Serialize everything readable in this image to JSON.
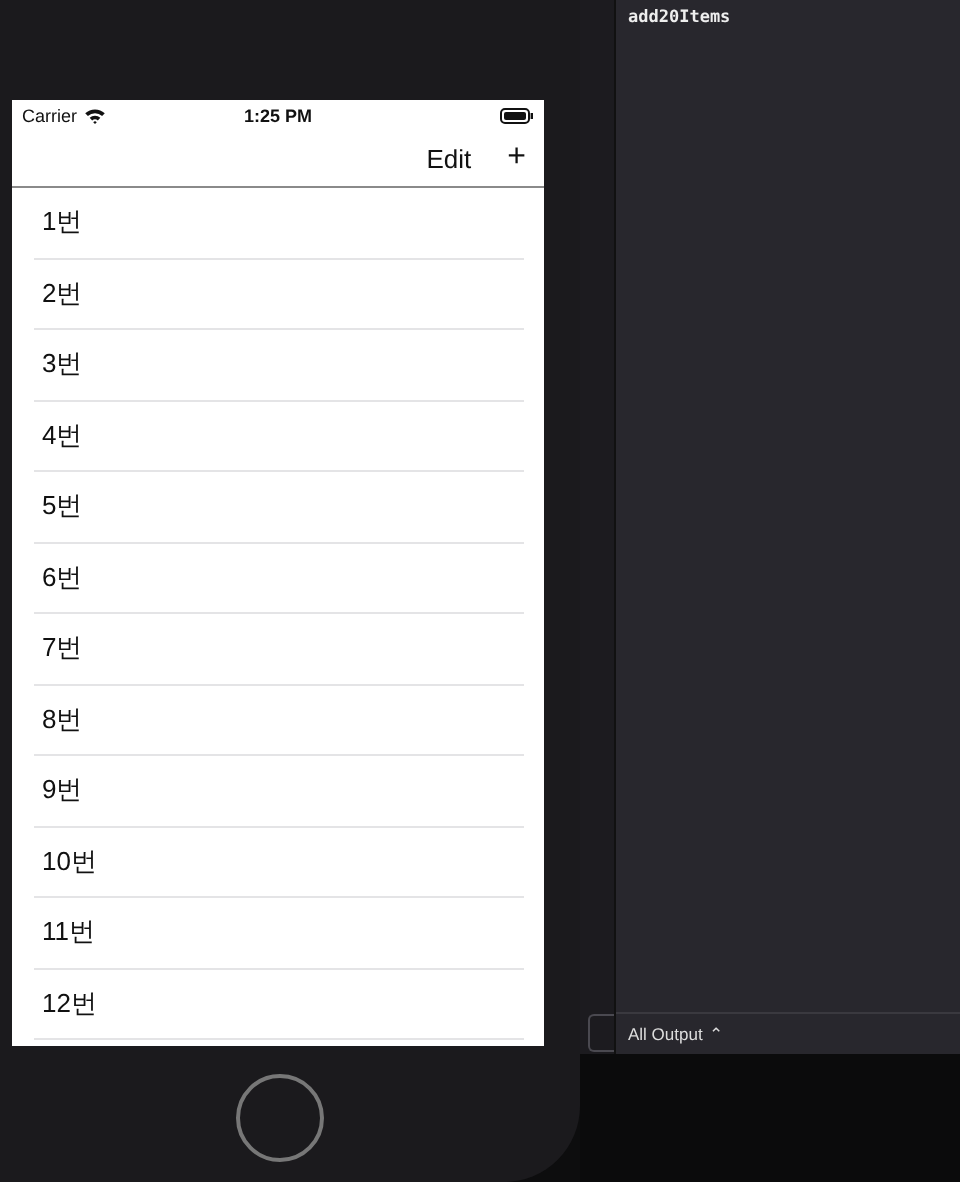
{
  "status_bar": {
    "carrier": "Carrier",
    "time": "1:25 PM"
  },
  "nav_bar": {
    "edit": "Edit",
    "add": "+"
  },
  "rows": [
    "1번",
    "2번",
    "3번",
    "4번",
    "5번",
    "6번",
    "7번",
    "8번",
    "9번",
    "10번",
    "11번",
    "12번"
  ],
  "console": {
    "output": "add20Items",
    "filter": "All Output",
    "filter_arrows": "⌃"
  }
}
